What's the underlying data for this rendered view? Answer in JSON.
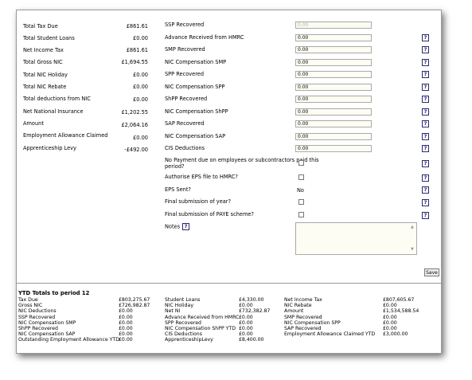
{
  "left_summary": [
    {
      "label": "Total Tax Due",
      "value": "£861.61"
    },
    {
      "label": "Total Student Loans",
      "value": "£0.00"
    },
    {
      "label": "Net Income Tax",
      "value": "£861.61"
    },
    {
      "label": "Total Gross NIC",
      "value": "£1,694.55"
    },
    {
      "label": "Total NIC Holiday",
      "value": "£0.00"
    },
    {
      "label": "Total NIC Rebate",
      "value": "£0.00"
    },
    {
      "label": "Total deductions from NIC",
      "value": "£0.00"
    },
    {
      "label": "Net National Insurance",
      "value": "£1,202.55"
    },
    {
      "label": "Amount",
      "value": "£2,064.16"
    },
    {
      "label": "Employment Allowance Claimed",
      "value": "£0.00"
    },
    {
      "label": "Apprenticeship Levy",
      "value": "-£492.00"
    }
  ],
  "right_fields": [
    {
      "label": "SSP Recovered",
      "value": "0.00",
      "disabled": true
    },
    {
      "label": "Advance Received from HMRC",
      "value": "0.00"
    },
    {
      "label": "SMP Recovered",
      "value": "0.00"
    },
    {
      "label": "NIC Compensation SMP",
      "value": "0.00"
    },
    {
      "label": "SPP Recovered",
      "value": "0.00"
    },
    {
      "label": "NIC Compensation SPP",
      "value": "0.00"
    },
    {
      "label": "ShPP Recovered",
      "value": "0.00"
    },
    {
      "label": "NIC Compensation ShPP",
      "value": "0.00"
    },
    {
      "label": "SAP Recovered",
      "value": "0.00"
    },
    {
      "label": "NIC Compensation SAP",
      "value": "0.00"
    },
    {
      "label": "CIS Deductions",
      "value": "0.00"
    }
  ],
  "checks": {
    "no_payment_line1": "No Payment due on employees or subcontractors paid this",
    "no_payment_line2": "period?",
    "authorise_eps": "Authorise EPS file to HMRC?",
    "eps_sent": "EPS Sent?",
    "eps_sent_value": "No",
    "final_year": "Final submission of year?",
    "final_paye": "Final submission of PAYE scheme?"
  },
  "notes_label": "Notes",
  "help_glyph": "?",
  "save_label": "Save",
  "ytd": {
    "title": "YTD Totals to period 12",
    "col1": [
      {
        "label": "Tax Due",
        "value": "£803,275.67"
      },
      {
        "label": "Gross NIC",
        "value": "£726,982.87"
      },
      {
        "label": "NIC Deductions",
        "value": "£0.00"
      },
      {
        "label": "SSP Recovered",
        "value": "£0.00"
      },
      {
        "label": "NIC Compensation SMP",
        "value": "£0.00"
      },
      {
        "label": "ShPP Recovered",
        "value": "£0.00"
      },
      {
        "label": "NIC Compensation SAP",
        "value": "£0.00"
      },
      {
        "label": "Outstanding Employment Allowance YTD",
        "value": "£0.00"
      }
    ],
    "col2": [
      {
        "label": "Student Loans",
        "value": "£4,330.00"
      },
      {
        "label": "NIC Holiday",
        "value": "£0.00"
      },
      {
        "label": "Net NI",
        "value": "£732,382.87"
      },
      {
        "label": "Advance Received from HMRC",
        "value": "£0.00"
      },
      {
        "label": "SPP Recovered",
        "value": "£0.00"
      },
      {
        "label": "NIC Compensation ShPP YTD",
        "value": "£0.00"
      },
      {
        "label": "CIS Deductions",
        "value": "£0.00"
      },
      {
        "label": "ApprenticeshipLevy",
        "value": "£8,400.00"
      }
    ],
    "col3": [
      {
        "label": "Net Income Tax",
        "value": "£807,605.67"
      },
      {
        "label": "NIC Rebate",
        "value": "£0.00"
      },
      {
        "label": "Amount",
        "value": "£1,534,588.54"
      },
      {
        "label": "SMP Recovered",
        "value": "£0.00"
      },
      {
        "label": "NIC Compensation SPP",
        "value": "£0.00"
      },
      {
        "label": "SAP Recovered",
        "value": "£0.00"
      },
      {
        "label": "Employment Allowance Claimed YTD",
        "value": "£3,000.00"
      }
    ]
  }
}
